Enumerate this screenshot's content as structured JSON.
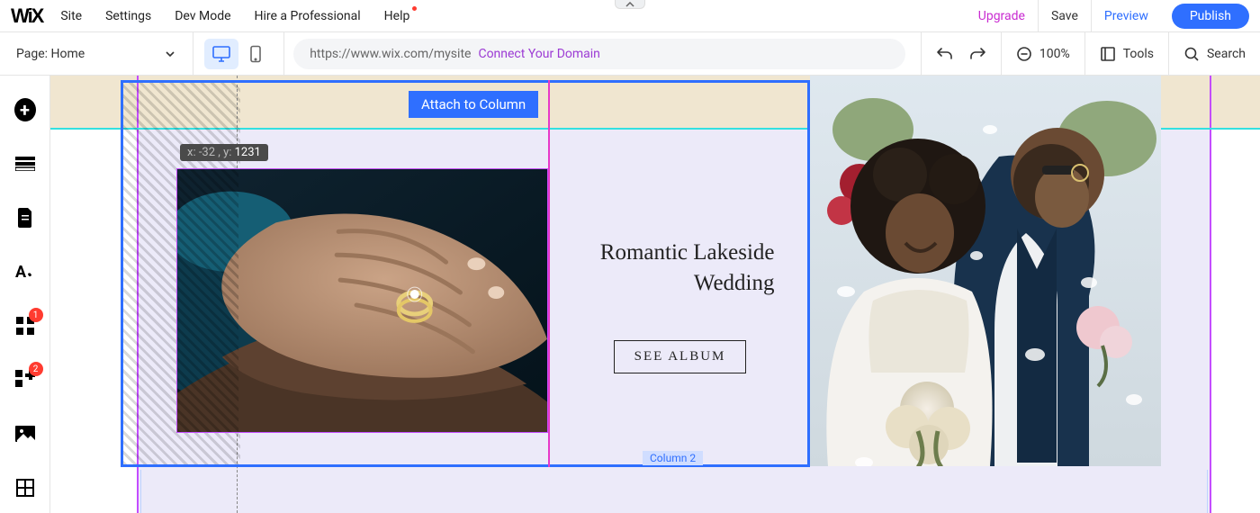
{
  "topbar": {
    "logo": "WiX",
    "menu": [
      "Site",
      "Settings",
      "Dev Mode",
      "Hire a Professional",
      "Help"
    ],
    "upgrade": "Upgrade",
    "save": "Save",
    "preview": "Preview",
    "publish": "Publish"
  },
  "secondbar": {
    "page_label": "Page: Home",
    "url": "https://www.wix.com/mysite",
    "connect_domain": "Connect Your Domain",
    "zoom": "100%",
    "tools": "Tools",
    "search": "Search"
  },
  "leftrail": {
    "badge_apps": "1",
    "badge_plugins": "2"
  },
  "editor": {
    "attach_button": "Attach to Column",
    "coord_x_label": "x:",
    "coord_x_value": "-32",
    "coord_y_label": ", y:",
    "coord_y_value": "1231",
    "heading": "Romantic Lakeside Wedding",
    "see_album": "SEE ALBUM",
    "column_label": "Column 2"
  }
}
